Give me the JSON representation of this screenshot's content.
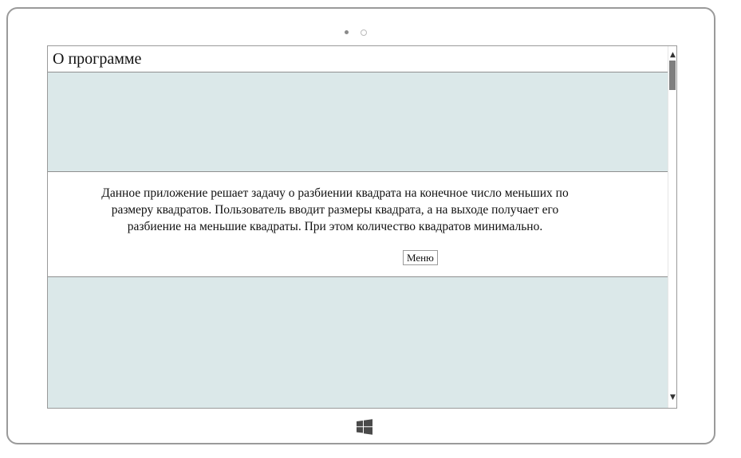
{
  "page": {
    "title": "О программе",
    "description": "Данное приложение решает задачу о разбиении квадрата на конечное число меньших по размеру квадратов. Пользователь вводит размеры квадрата, а на выходе получает его разбиение на меньшие квадраты. При этом количество квадратов минимально.",
    "menu_button_label": "Меню"
  },
  "icons": {
    "camera": "camera-dots-icon",
    "scroll_up": "scroll-up-arrow-icon",
    "scroll_down": "scroll-down-arrow-icon",
    "windows": "windows-logo-icon"
  },
  "colors": {
    "content_background": "#dbe8e9",
    "panel_background": "#ffffff",
    "frame_border": "#9a9a9a",
    "scroll_thumb": "#7f7f7f",
    "windows_logo": "#4a4a4a"
  }
}
